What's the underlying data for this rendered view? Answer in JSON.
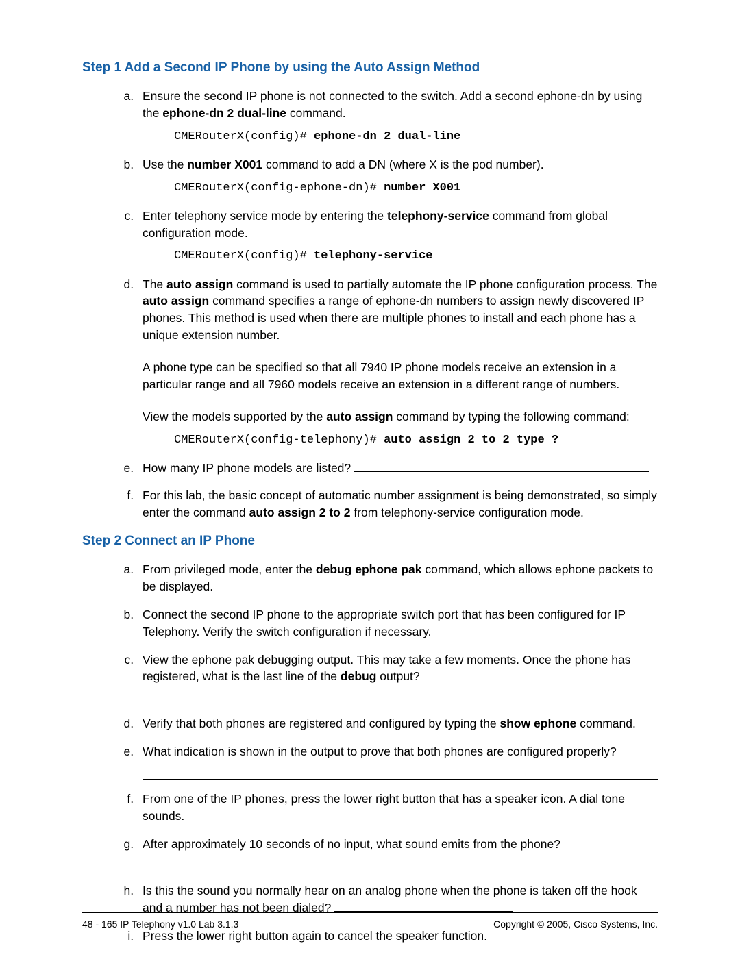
{
  "step1": {
    "title": "Step 1 Add a Second IP Phone by using the Auto Assign Method",
    "a_pre": "Ensure the second IP phone is not connected to the switch. Add a second ephone-dn by using the ",
    "a_bold": "ephone-dn 2 dual-line",
    "a_post": " command.",
    "a_code_prompt": "CMERouterX(config)# ",
    "a_code_cmd": "ephone-dn 2 dual-line",
    "b_pre": "Use the ",
    "b_bold": "number X001",
    "b_post": " command to add a DN (where X is the pod number).",
    "b_code_prompt": "CMERouterX(config-ephone-dn)# ",
    "b_code_cmd": "number X001",
    "c_pre": "Enter telephony service mode by entering the ",
    "c_bold": "telephony-service",
    "c_post": " command from global configuration mode.",
    "c_code_prompt": "CMERouterX(config)# ",
    "c_code_cmd": "telephony-service",
    "d_pre": "The ",
    "d_bold1": "auto assign",
    "d_mid1": " command is used to partially automate the IP phone configuration process. The ",
    "d_bold2": "auto assign",
    "d_mid2": " command specifies a range of ephone-dn numbers to assign newly discovered IP phones. This method is used when there are multiple phones to install and each phone has a unique extension number.",
    "d_p2": "A phone type can be specified so that all 7940 IP phone models receive an extension in a particular range and all 7960 models receive an extension in a different range of numbers.",
    "d_p3_pre": "View the models supported by the ",
    "d_p3_bold": "auto assign",
    "d_p3_post": " command by typing the following command:",
    "d_code_prompt": "CMERouterX(config-telephony)# ",
    "d_code_cmd": "auto assign 2 to 2 type ?",
    "e_text": "How many IP phone models are listed? ",
    "f_pre": "For this lab, the basic concept of automatic number assignment is being demonstrated, so simply enter the command ",
    "f_bold": "auto assign 2 to 2",
    "f_post": " from telephony-service configuration mode."
  },
  "step2": {
    "title": "Step 2 Connect an IP Phone",
    "a_pre": "From privileged mode, enter the ",
    "a_bold": "debug ephone pak",
    "a_post": " command, which allows ephone packets to be displayed.",
    "b_text": "Connect the second IP phone to the appropriate switch port that has been configured for IP Telephony. Verify the switch configuration if necessary.",
    "c_pre": "View the ephone pak debugging output. This may take a few moments. Once the phone has registered, what is the last line of the ",
    "c_bold": "debug",
    "c_post": " output?",
    "d_pre": "Verify that both phones are registered and configured by typing the ",
    "d_bold": "show ephone",
    "d_post": " command.",
    "e_text": "What indication is shown in the output to prove that both phones are configured properly?",
    "f_text": "From one of the IP phones, press the lower right button that has a speaker icon. A dial tone sounds.",
    "g_text": "After approximately 10 seconds of no input, what sound emits from the phone?",
    "h_text": "Is this the sound you normally hear on an analog phone when the phone is taken off the hook and a number has not been dialed? ",
    "i_text": "Press the lower right button again to cancel the speaker function."
  },
  "footer": {
    "left": "48 - 165   IP Telephony v1.0   Lab 3.1.3",
    "right": "Copyright © 2005, Cisco Systems, Inc."
  }
}
